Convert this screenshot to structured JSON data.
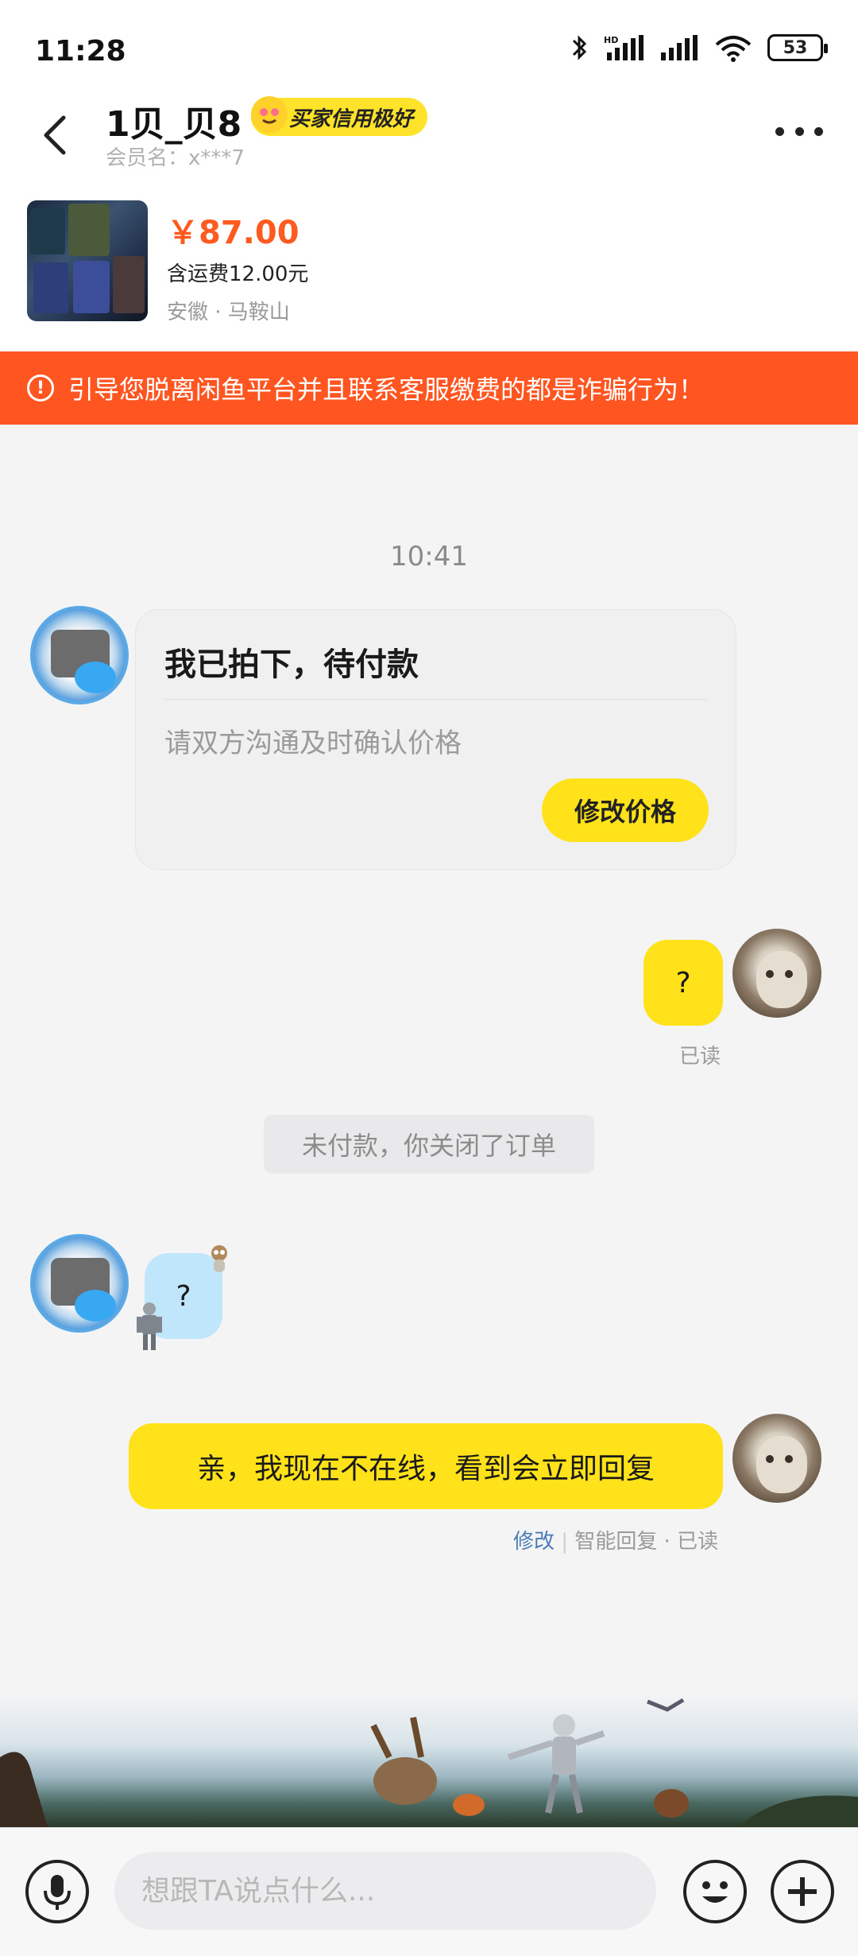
{
  "status_bar": {
    "time": "11:28",
    "battery": "53"
  },
  "header": {
    "seller_name": "1贝_贝8",
    "credit_badge": "买家信用极好",
    "member_name": "会员名：x***7"
  },
  "product": {
    "price": "￥87.00",
    "shipping": "含运费12.00元",
    "location": "安徽 · 马鞍山"
  },
  "warning": {
    "text": "引导您脱离闲鱼平台并且联系客服缴费的都是诈骗行为！"
  },
  "chat": {
    "timestamp": "10:41",
    "order_card": {
      "title": "我已拍下，待付款",
      "subtitle": "请双方沟通及时确认价格",
      "button_label": "修改价格"
    },
    "buyer_message_1": {
      "text": "?",
      "status": "已读"
    },
    "system_notice": "未付款，你关闭了订单",
    "seller_message_1": {
      "text": "?"
    },
    "buyer_message_2": {
      "text": "亲，我现在不在线，看到会立即回复",
      "edit_label": "修改",
      "meta_text": "智能回复 · 已读"
    }
  },
  "input_bar": {
    "placeholder": "想跟TA说点什么..."
  },
  "colors": {
    "accent_yellow": "#ffe21a",
    "warning_orange": "#ff5520",
    "price_orange": "#ff5a1f",
    "link_blue": "#4a7cb8"
  },
  "icons": [
    "bluetooth-icon",
    "hd-signal-icon",
    "signal-icon",
    "wifi-icon",
    "battery-icon",
    "back-arrow-icon",
    "more-icon",
    "warning-icon",
    "mic-icon",
    "emoji-icon",
    "plus-icon"
  ]
}
